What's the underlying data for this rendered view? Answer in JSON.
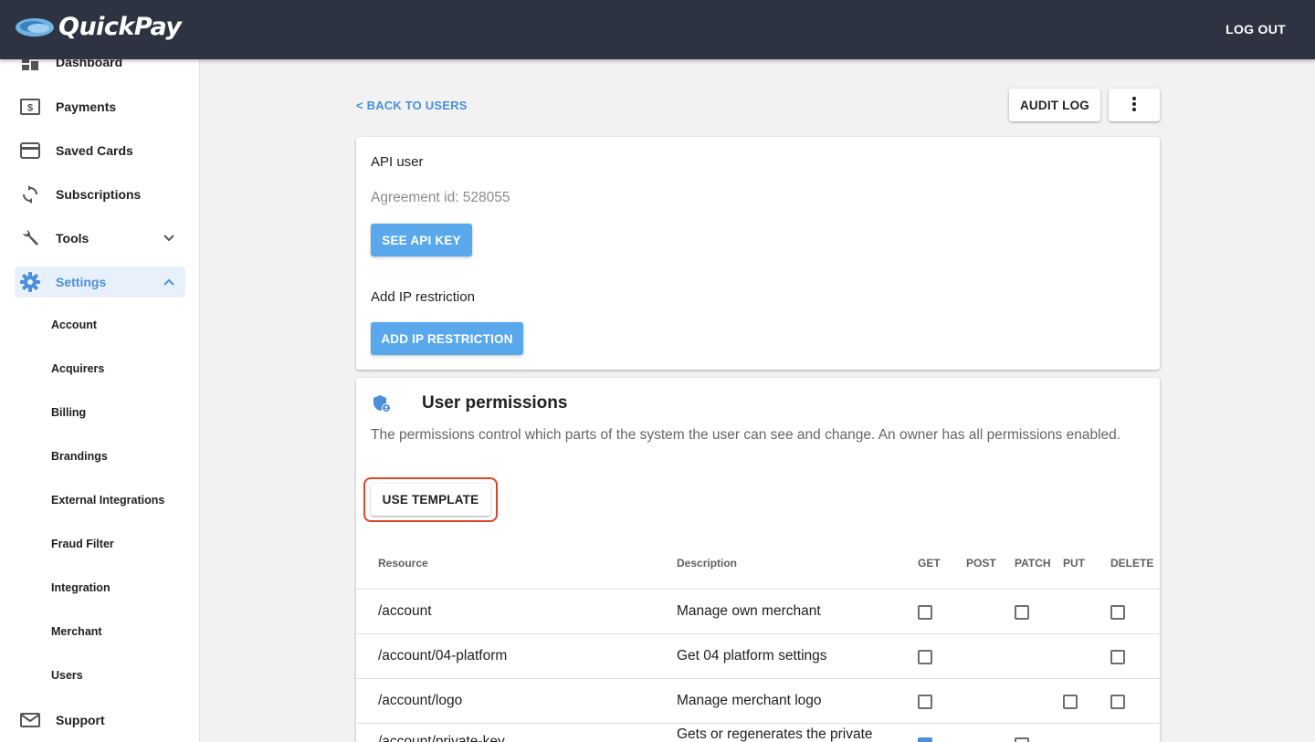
{
  "app": {
    "name": "QuickPay",
    "logout_label": "LOG OUT"
  },
  "sidebar": {
    "items": [
      {
        "label": "Dashboard",
        "icon": "dashboard-icon"
      },
      {
        "label": "Payments",
        "icon": "dollar-icon"
      },
      {
        "label": "Saved Cards",
        "icon": "credit-card-icon"
      },
      {
        "label": "Subscriptions",
        "icon": "refresh-icon"
      },
      {
        "label": "Tools",
        "icon": "wrench-icon"
      },
      {
        "label": "Settings",
        "icon": "gear-icon"
      }
    ],
    "settings_subitems": [
      "Account",
      "Acquirers",
      "Billing",
      "Brandings",
      "External Integrations",
      "Fraud Filter",
      "Integration",
      "Merchant",
      "Users"
    ],
    "support_label": "Support",
    "accent_color": "#4a90d9"
  },
  "header": {
    "back_label": "< BACK TO USERS",
    "audit_log_label": "AUDIT LOG",
    "more_icon": "vertical-dots-icon"
  },
  "api_user": {
    "title": "API user",
    "agreement": "Agreement id: 528055",
    "see_api_key_label": "SEE API KEY",
    "ip_title": "Add IP restriction",
    "add_ip_label": "ADD IP RESTRICTION"
  },
  "permissions": {
    "title": "User permissions",
    "description": "The permissions control which parts of the system the user can see and change. An owner has all permissions enabled.",
    "use_template_label": "USE TEMPLATE",
    "columns": [
      "Resource",
      "Description",
      "GET",
      "POST",
      "PATCH",
      "PUT",
      "DELETE"
    ],
    "rows": [
      {
        "resource": "/account",
        "description": "Manage own merchant"
      },
      {
        "resource": "/account/04-platform",
        "description": "Get 04 platform settings"
      },
      {
        "resource": "/account/logo",
        "description": "Manage merchant logo"
      },
      {
        "resource": "/account/private-key",
        "description": "Gets or regenerates the private"
      }
    ]
  }
}
